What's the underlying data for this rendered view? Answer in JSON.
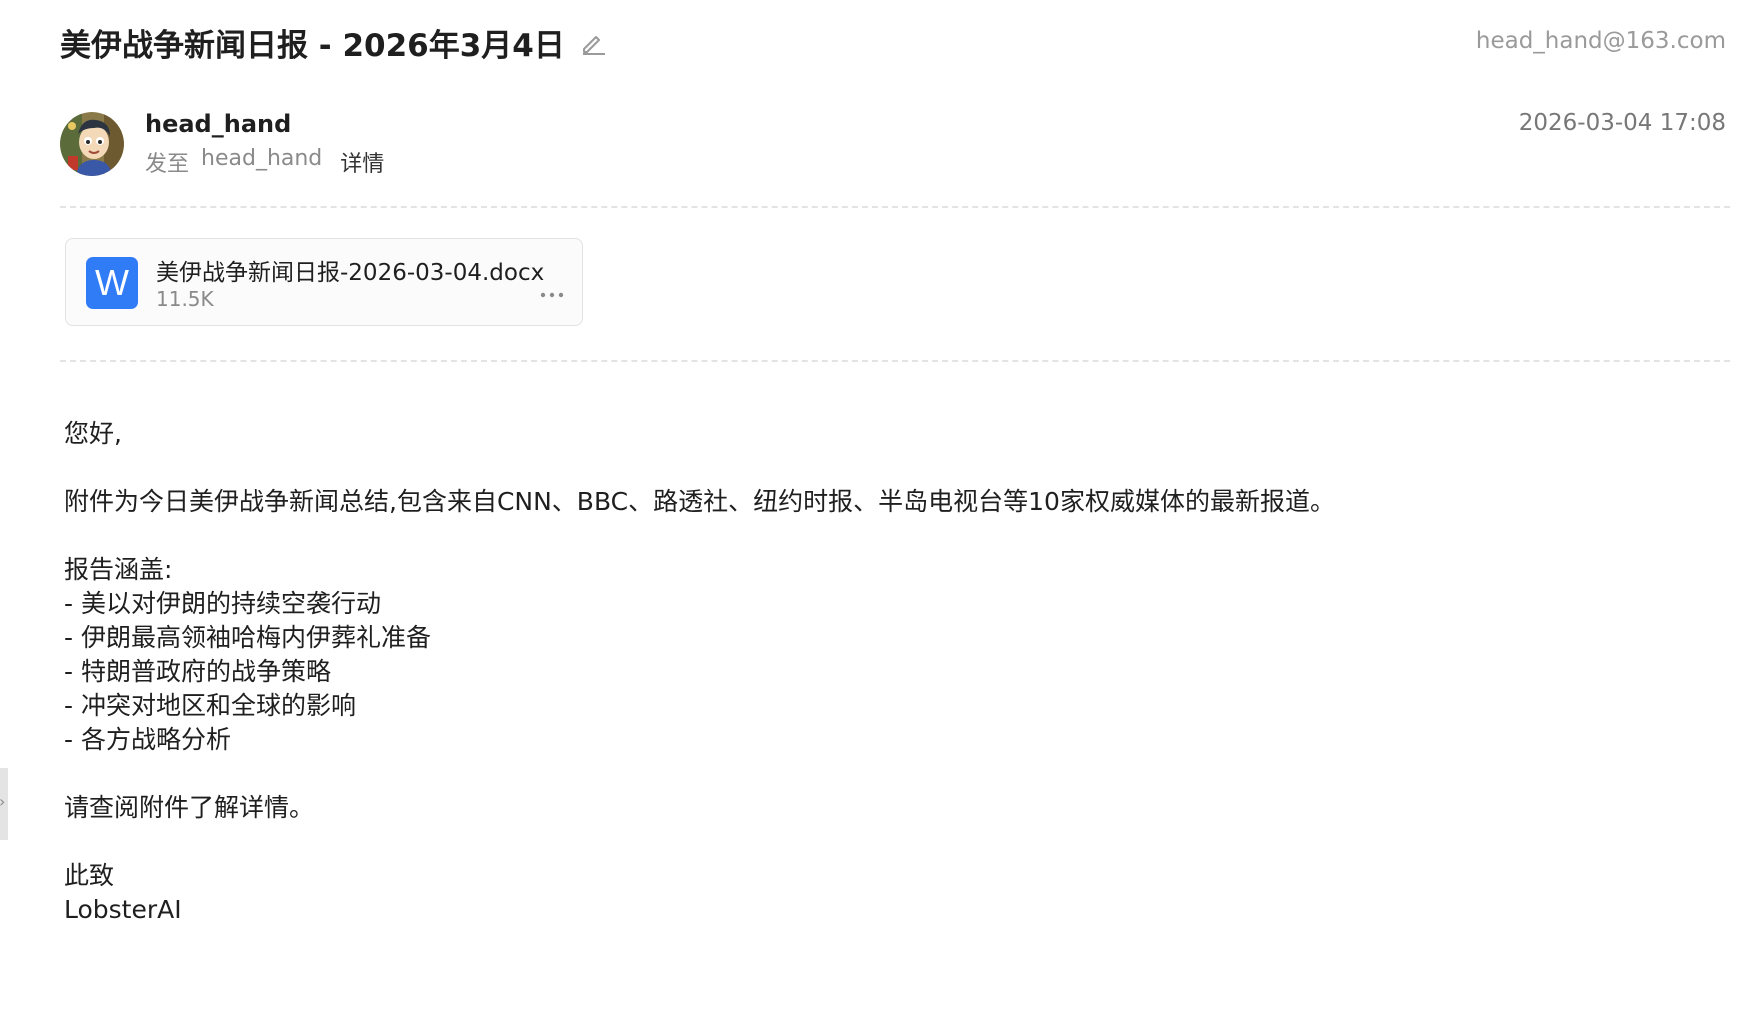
{
  "email": {
    "subject": "美伊战争新闻日报 - 2026年3月4日",
    "account": "head_hand@163.com",
    "sender": {
      "name": "head_hand",
      "to_prefix": "发至",
      "recipient": "head_hand",
      "details_label": "详情"
    },
    "date": "2026-03-04 17:08",
    "attachment": {
      "icon_letter": "W",
      "filename": "美伊战争新闻日报-2026-03-04.docx",
      "size": "11.5K",
      "more_label": "···"
    },
    "body": {
      "greeting": "您好,",
      "intro": "附件为今日美伊战争新闻总结,包含来自CNN、BBC、路透社、纽约时报、半岛电视台等10家权威媒体的最新报道。",
      "report_heading": "报告涵盖:",
      "items": [
        "- 美以对伊朗的持续空袭行动",
        "- 伊朗最高领袖哈梅内伊葬礼准备",
        "- 特朗普政府的战争策略",
        "- 冲突对地区和全球的影响",
        "- 各方战略分析"
      ],
      "closing": "请查阅附件了解详情。",
      "regards": "此致",
      "signature": "LobsterAI"
    }
  },
  "icons": {
    "edit": "pencil-icon",
    "avatar": "avatar-image",
    "attachment_type": "word-document-icon",
    "more": "more-horizontal-icon",
    "side": "chevron-right-icon"
  },
  "colors": {
    "accent_word": "#2f7cf6",
    "muted_text": "#8a8a8a",
    "divider": "#e3e3e3"
  }
}
